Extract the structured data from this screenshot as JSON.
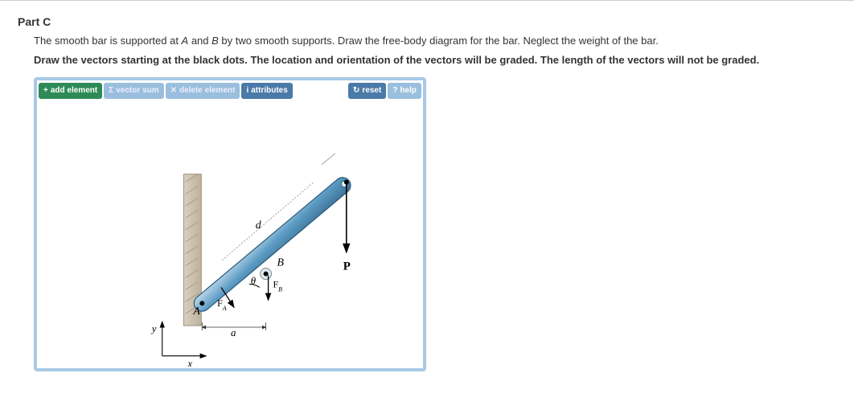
{
  "part": {
    "label": "Part C",
    "description_prefix": "The smooth bar is supported at ",
    "point_a": "A",
    "description_mid": " and ",
    "point_b": "B",
    "description_suffix": " by two smooth supports. Draw the free-body diagram for the bar. Neglect the weight of the bar.",
    "instruction": "Draw the vectors starting at the black dots. The location and orientation of the vectors will be graded. The length of the vectors will not be graded."
  },
  "toolbar": {
    "add_element": "add element",
    "vector_sum": "vector sum",
    "delete_element": "delete element",
    "attributes": "attributes",
    "reset": "reset",
    "help": "help",
    "icons": {
      "add": "+",
      "sum": "Σ",
      "delete": "✕",
      "attributes": "i",
      "reset": "↻",
      "help": "?"
    }
  },
  "figure": {
    "point_A": "A",
    "point_B": "B",
    "FA": "F",
    "FA_sub": "A",
    "FB": "F",
    "FB_sub": "B",
    "theta": "θ",
    "P": "P",
    "d": "d",
    "a": "a",
    "x": "x",
    "y": "y"
  }
}
